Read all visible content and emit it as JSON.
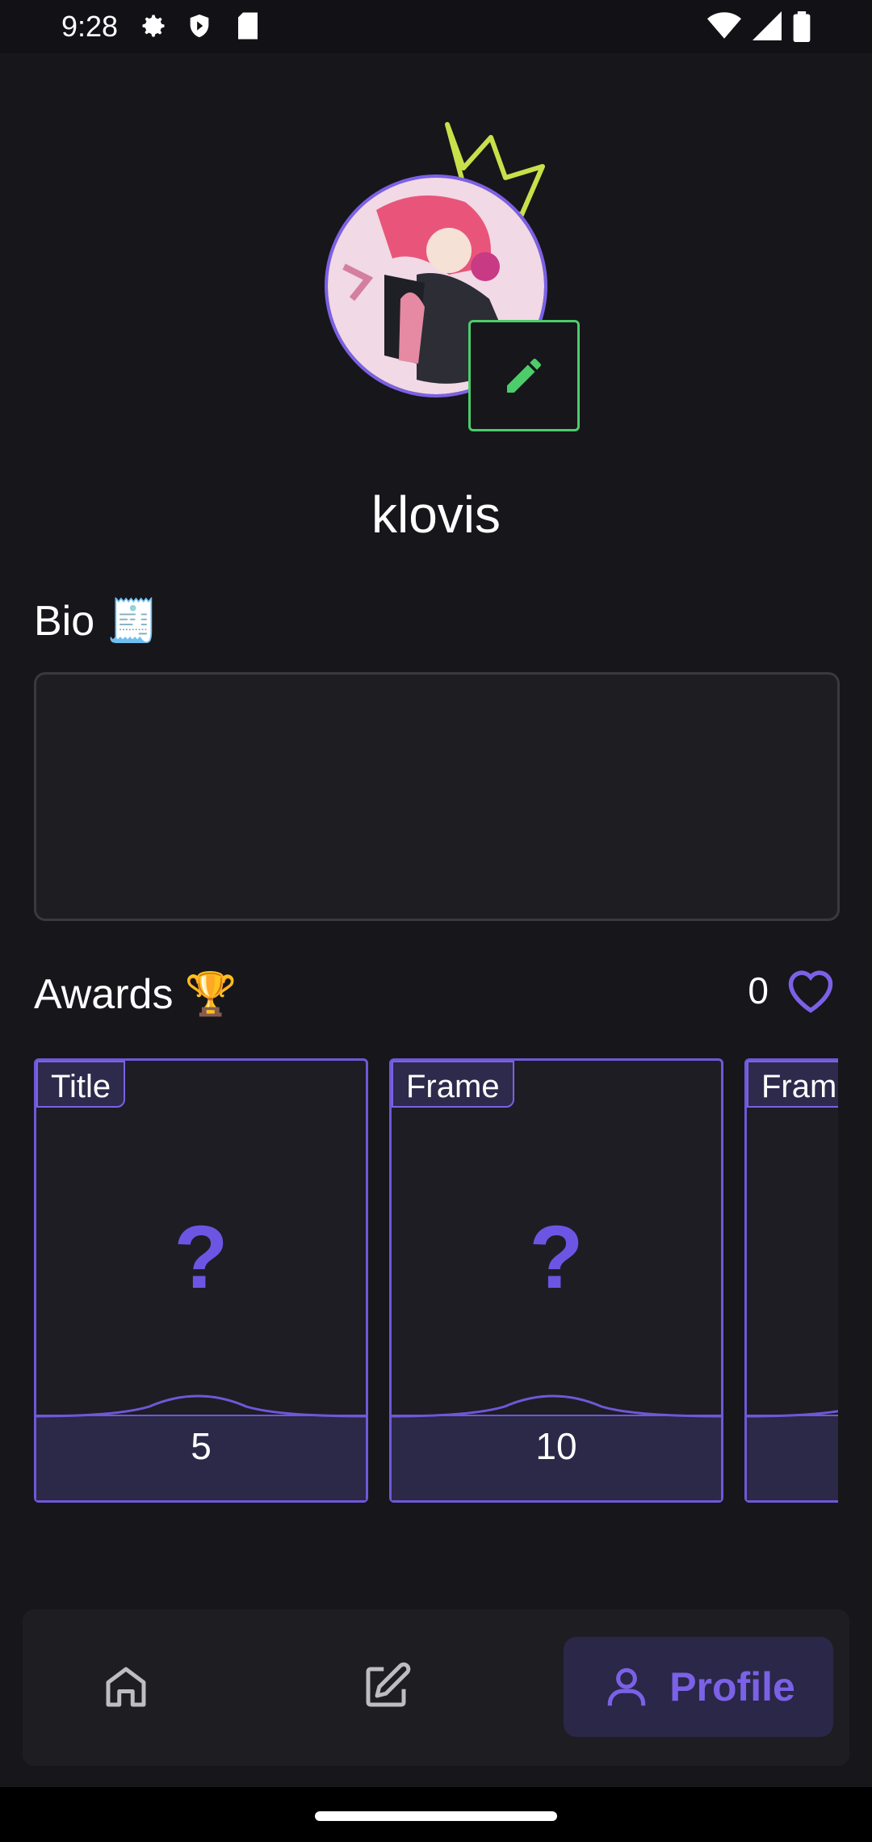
{
  "status_bar": {
    "time": "9:28"
  },
  "profile": {
    "username": "klovis"
  },
  "bio": {
    "title": "Bio 🧾",
    "text": ""
  },
  "awards": {
    "title": "Awards 🏆",
    "likes": "0",
    "cards": [
      {
        "tag": "Title",
        "placeholder": "?",
        "value": "5"
      },
      {
        "tag": "Frame",
        "placeholder": "?",
        "value": "10"
      },
      {
        "tag": "Frame",
        "placeholder": "?",
        "value": ""
      }
    ]
  },
  "nav": {
    "profile_label": "Profile"
  },
  "colors": {
    "accent": "#7b61e6",
    "edit_green": "#4ccc6a",
    "crown": "#c8e04a",
    "background": "#17161b"
  }
}
